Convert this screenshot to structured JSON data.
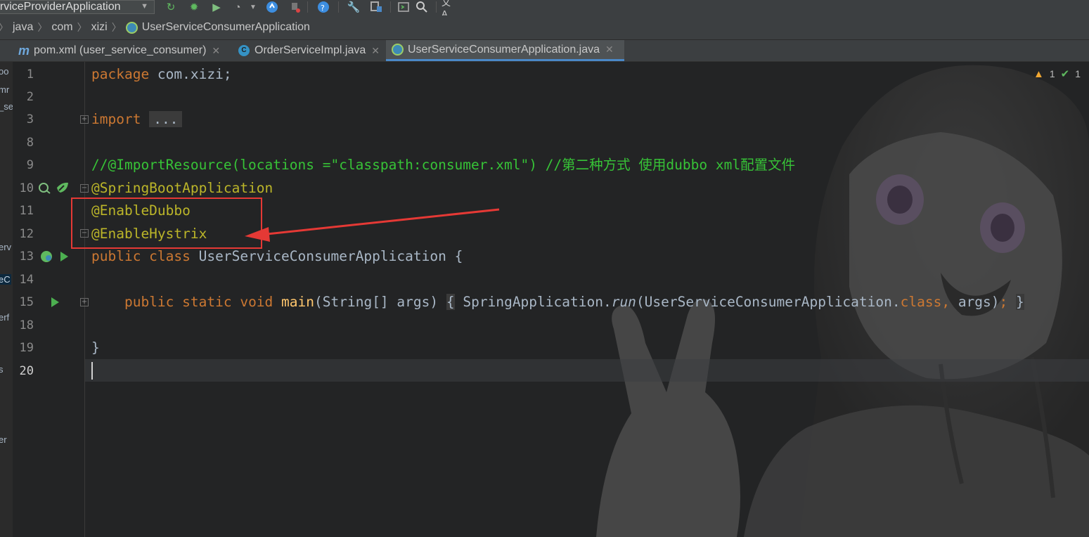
{
  "toolbar": {
    "run_config": "erviceProviderApplication",
    "icons": [
      "rerun-icon",
      "debug-icon",
      "run-coverage-icon",
      "profile-icon",
      "dropdown-icon",
      "update-icon",
      "stop-icon",
      "help-icon",
      "settings-icon",
      "project-structure-icon",
      "terminal-icon",
      "search-icon",
      "translate-icon"
    ]
  },
  "breadcrumb": {
    "items": [
      "java",
      "com",
      "xizi",
      "UserServiceConsumerApplication"
    ]
  },
  "tabs": [
    {
      "label": "pom.xml (user_service_consumer)",
      "icon": "maven-icon",
      "active": false
    },
    {
      "label": "OrderServiceImpl.java",
      "icon": "class-icon",
      "active": false
    },
    {
      "label": "UserServiceConsumerApplication.java",
      "icon": "spring-app-icon",
      "active": true
    }
  ],
  "project_strip": {
    "fragments": [
      "oo",
      "mr",
      "_se",
      "erv",
      "eC",
      "erf",
      "s",
      "er"
    ]
  },
  "inspections": {
    "warnings": "1",
    "ok": "1"
  },
  "editor": {
    "line_numbers": [
      "1",
      "2",
      "3",
      "8",
      "9",
      "10",
      "11",
      "12",
      "13",
      "14",
      "15",
      "18",
      "19",
      "20"
    ],
    "current_line": "20",
    "code": {
      "l1_kw": "package",
      "l1_rest": " com.xizi;",
      "l3_kw": "import",
      "l3_fold": "...",
      "l9_comment": "//@ImportResource(locations =\"classpath:consumer.xml\") //第二种方式 使用dubbo xml配置文件",
      "l10_ann": "@SpringBootApplication",
      "l11_ann": "@EnableDubbo",
      "l12_ann": "@EnableHystrix",
      "l13_kw": "public class",
      "l13_rest": " UserServiceConsumerApplication {",
      "l15_kw": "public static void",
      "l15_fn": "main",
      "l15_params": "(String[] args)",
      "l15_open": "{",
      "l15_call": "SpringApplication.",
      "l15_run": "run",
      "l15_args": "(UserServiceConsumerApplication.",
      "l15_class": "class",
      "l15_comma": ", ",
      "l15_args2": "args)",
      "l15_semi": ";",
      "l15_close": "}",
      "l19": "}"
    }
  },
  "annotation_overlay": {
    "box_color": "#e53935",
    "arrow_color": "#e53935"
  }
}
